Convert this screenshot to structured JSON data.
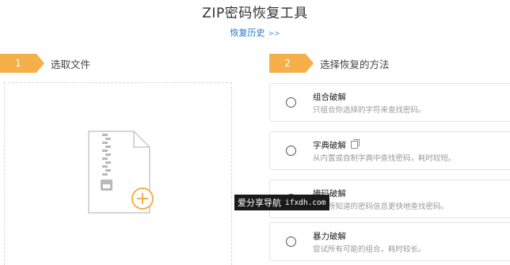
{
  "header": {
    "title": "ZIP密码恢复工具",
    "history_link": "恢复历史",
    "history_arrows": ">>"
  },
  "steps": [
    {
      "number": "1",
      "label": "选取文件"
    },
    {
      "number": "2",
      "label": "选择恢复的方法"
    }
  ],
  "dropzone": {
    "icon": "zip-file-icon",
    "add_icon": "plus-circle-icon"
  },
  "methods": [
    {
      "title": "组合破解",
      "desc": "只组合你选择的字符来查找密码。",
      "selected": false
    },
    {
      "title": "字典破解",
      "desc": "从内置或自制字典中查找密码，耗时较短。",
      "selected": false,
      "extra_icon": "copy-icon"
    },
    {
      "title": "掩码破解",
      "desc": "用你所知道的密码信息更快地查找密码。",
      "selected": false
    },
    {
      "title": "暴力破解",
      "desc": "尝试所有可能的组合，耗时较长。",
      "selected": false
    }
  ],
  "watermark": {
    "text": "爱分享导航",
    "domain": "ifxdh.com"
  },
  "colors": {
    "accent": "#f5b04a",
    "link": "#1e73c9"
  }
}
